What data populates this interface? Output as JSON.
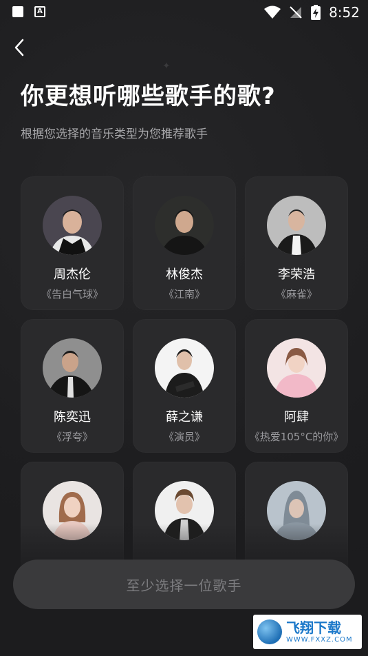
{
  "status_bar": {
    "time": "8:52"
  },
  "header": {
    "title": "你更想听哪些歌手的歌?",
    "subtitle": "根据您选择的音乐类型为您推荐歌手"
  },
  "singers": [
    {
      "name": "周杰伦",
      "song": "《告白气球》"
    },
    {
      "name": "林俊杰",
      "song": "《江南》"
    },
    {
      "name": "李荣浩",
      "song": "《麻雀》"
    },
    {
      "name": "陈奕迅",
      "song": "《浮夸》"
    },
    {
      "name": "薛之谦",
      "song": "《演员》"
    },
    {
      "name": "阿肆",
      "song": "《热爱105°C的你》"
    },
    {
      "name": "",
      "song": ""
    },
    {
      "name": "",
      "song": ""
    },
    {
      "name": "",
      "song": ""
    }
  ],
  "cta": {
    "label": "至少选择一位歌手"
  },
  "watermark": {
    "title": "飞翔下载",
    "url": "WWW.FXXZ.COM"
  },
  "colors": {
    "background": "#1c1c1e",
    "card": "#2a2a2c",
    "button": "#3a3a3c",
    "button_text": "#7d7d80",
    "watermark_blue": "#1b78c9"
  }
}
